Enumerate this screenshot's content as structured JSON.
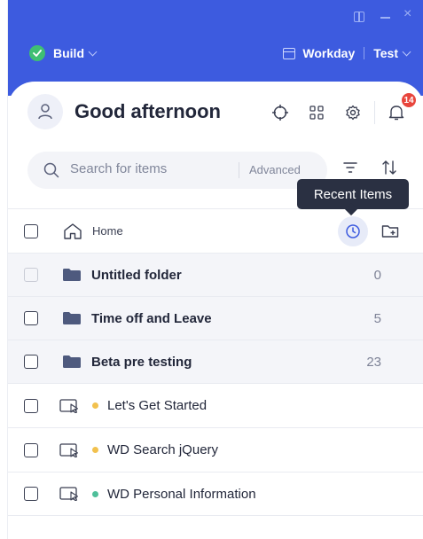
{
  "window": {
    "restore_icon": "window-restore-icon",
    "minimize_icon": "minimize-icon",
    "close_icon": "close-icon"
  },
  "header": {
    "mode_label": "Build",
    "workspace_label": "Workday",
    "environment_label": "Test",
    "accent": "#3d5bdf"
  },
  "greeting": {
    "text": "Good afternoon",
    "notification_count": "14"
  },
  "search": {
    "placeholder": "Search for items",
    "advanced_label": "Advanced"
  },
  "tooltip": {
    "text": "Recent Items"
  },
  "home": {
    "label": "Home"
  },
  "folders": [
    {
      "label": "Untitled folder",
      "count": "0"
    },
    {
      "label": "Time off and Leave",
      "count": "5"
    },
    {
      "label": "Beta pre testing",
      "count": "23"
    }
  ],
  "items": [
    {
      "label": "Let's Get Started",
      "status_color": "#f2c14e"
    },
    {
      "label": "WD Search jQuery",
      "status_color": "#f2c14e"
    },
    {
      "label": "WD Personal Information",
      "status_color": "#4fbf9a"
    }
  ]
}
